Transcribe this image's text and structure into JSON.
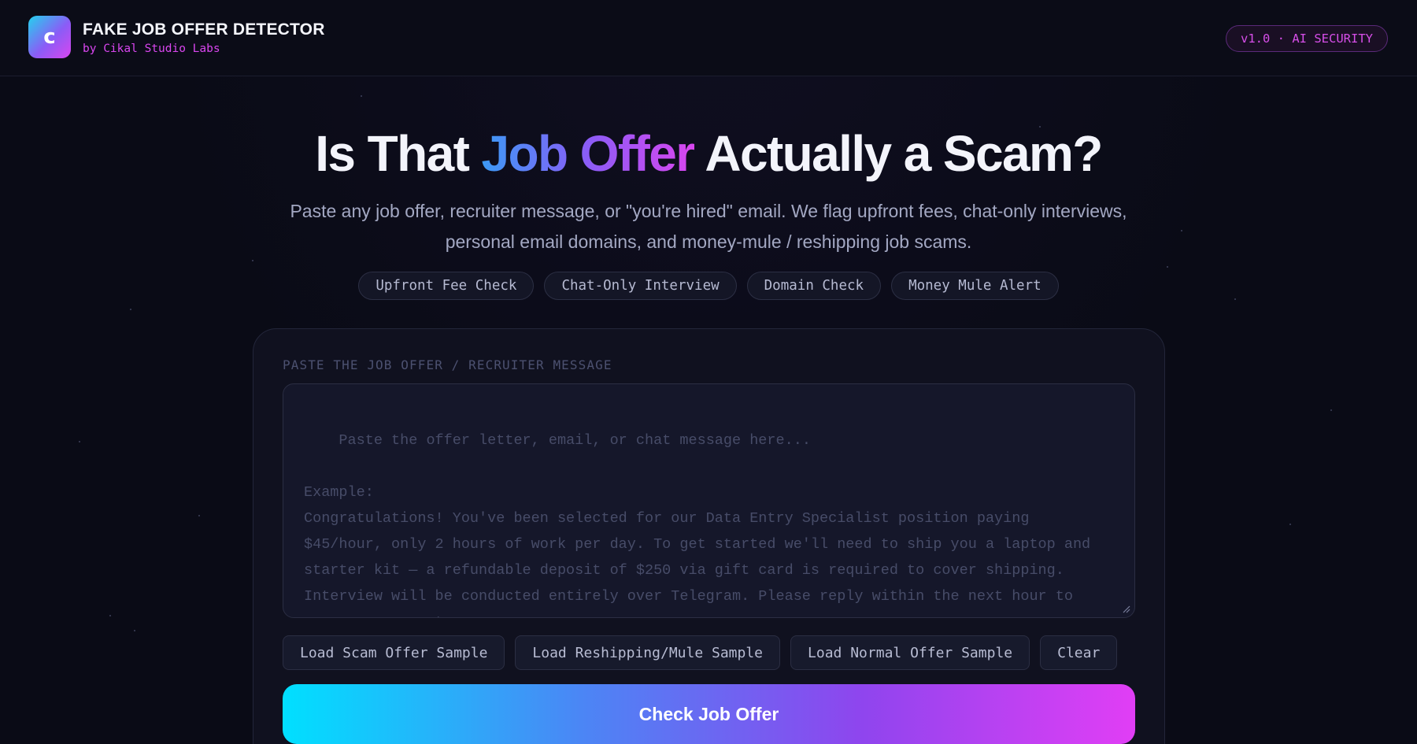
{
  "header": {
    "logo_letter": "c",
    "title": "FAKE JOB OFFER DETECTOR",
    "subtitle": "by Cikal Studio Labs",
    "version_badge": "v1.0 · AI SECURITY"
  },
  "hero": {
    "title_before": "Is That ",
    "title_accent": "Job Offer",
    "title_after": " Actually a Scam?",
    "description": "Paste any job offer, recruiter message, or \"you're hired\" email. We flag upfront fees, chat-only interviews, personal email domains, and money-mule / reshipping job scams.",
    "chips": [
      "Upfront Fee Check",
      "Chat-Only Interview",
      "Domain Check",
      "Money Mule Alert"
    ]
  },
  "form": {
    "label": "PASTE THE JOB OFFER / RECRUITER MESSAGE",
    "placeholder": "Paste the offer letter, email, or chat message here...\n\nExample:\nCongratulations! You've been selected for our Data Entry Specialist position paying $45/hour, only 2 hours of work per day. To get started we'll need to ship you a laptop and starter kit — a refundable deposit of $250 via gift card is required to cover shipping. Interview will be conducted entirely over Telegram. Please reply within the next hour to secure your spot.",
    "sample_buttons": [
      "Load Scam Offer Sample",
      "Load Reshipping/Mule Sample",
      "Load Normal Offer Sample",
      "Clear"
    ],
    "submit_label": "Check Job Offer"
  },
  "colors": {
    "background": "#0a0b16",
    "accent_pink": "#d946ef",
    "accent_purple": "#8b5cf6",
    "accent_cyan": "#00e0ff"
  }
}
